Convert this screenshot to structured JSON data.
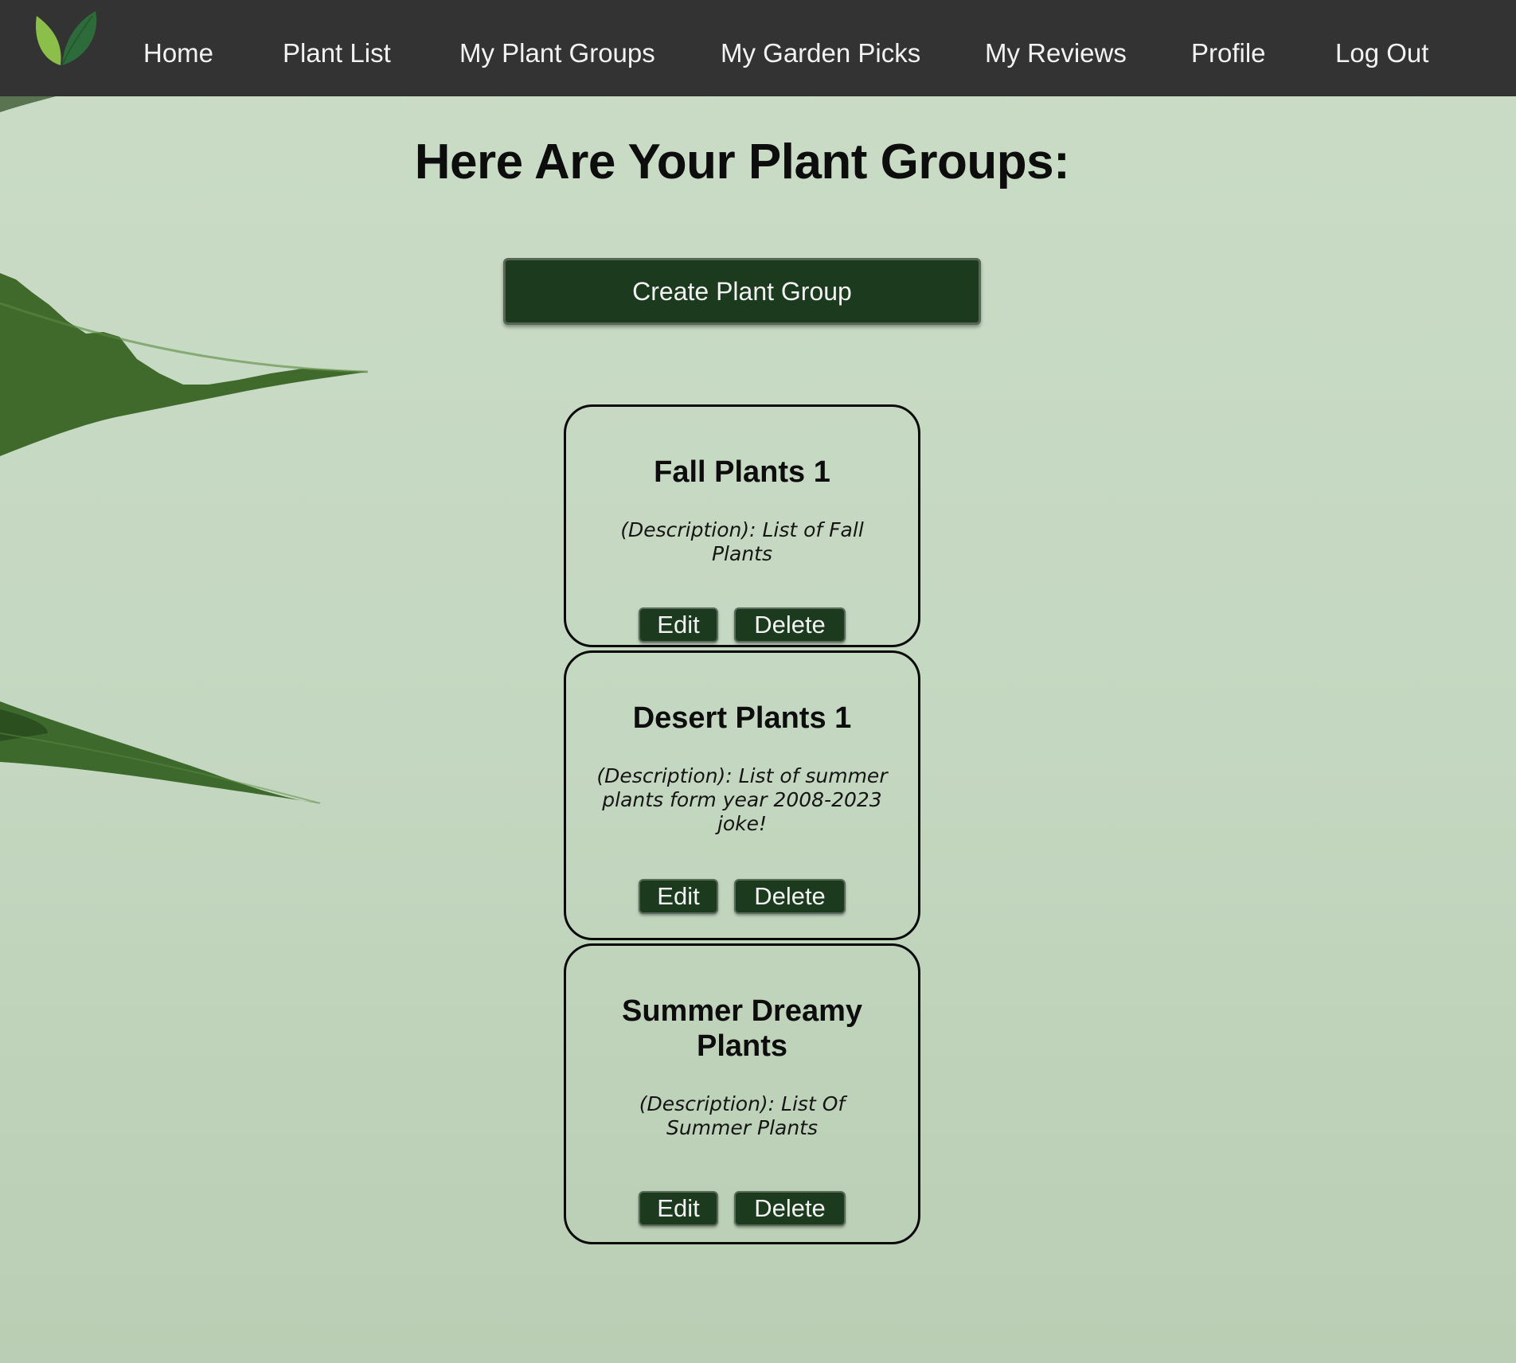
{
  "nav": {
    "items": [
      {
        "label": "Home"
      },
      {
        "label": "Plant List"
      },
      {
        "label": "My Plant Groups"
      },
      {
        "label": "My Garden Picks"
      },
      {
        "label": "My Reviews"
      },
      {
        "label": "Profile"
      },
      {
        "label": "Log Out"
      }
    ]
  },
  "main": {
    "title": "Here Are Your Plant Groups:",
    "create_button_label": "Create Plant Group",
    "groups": [
      {
        "name": "Fall Plants 1",
        "description": "(Description): List of Fall Plants",
        "edit_label": "Edit",
        "delete_label": "Delete"
      },
      {
        "name": "Desert Plants 1",
        "description": "(Description): List of summer plants form year 2008-2023 joke!",
        "edit_label": "Edit",
        "delete_label": "Delete"
      },
      {
        "name": "Summer Dreamy Plants",
        "description": "(Description): List Of Summer Plants",
        "edit_label": "Edit",
        "delete_label": "Delete"
      }
    ]
  },
  "colors": {
    "navbar": "#333333",
    "button": "#1b3a1e",
    "background": "#c4d7c0",
    "logo_light": "#8bbf4a",
    "logo_dark": "#2e6b3a"
  },
  "icons": {
    "logo": "leaf-logo-icon"
  }
}
